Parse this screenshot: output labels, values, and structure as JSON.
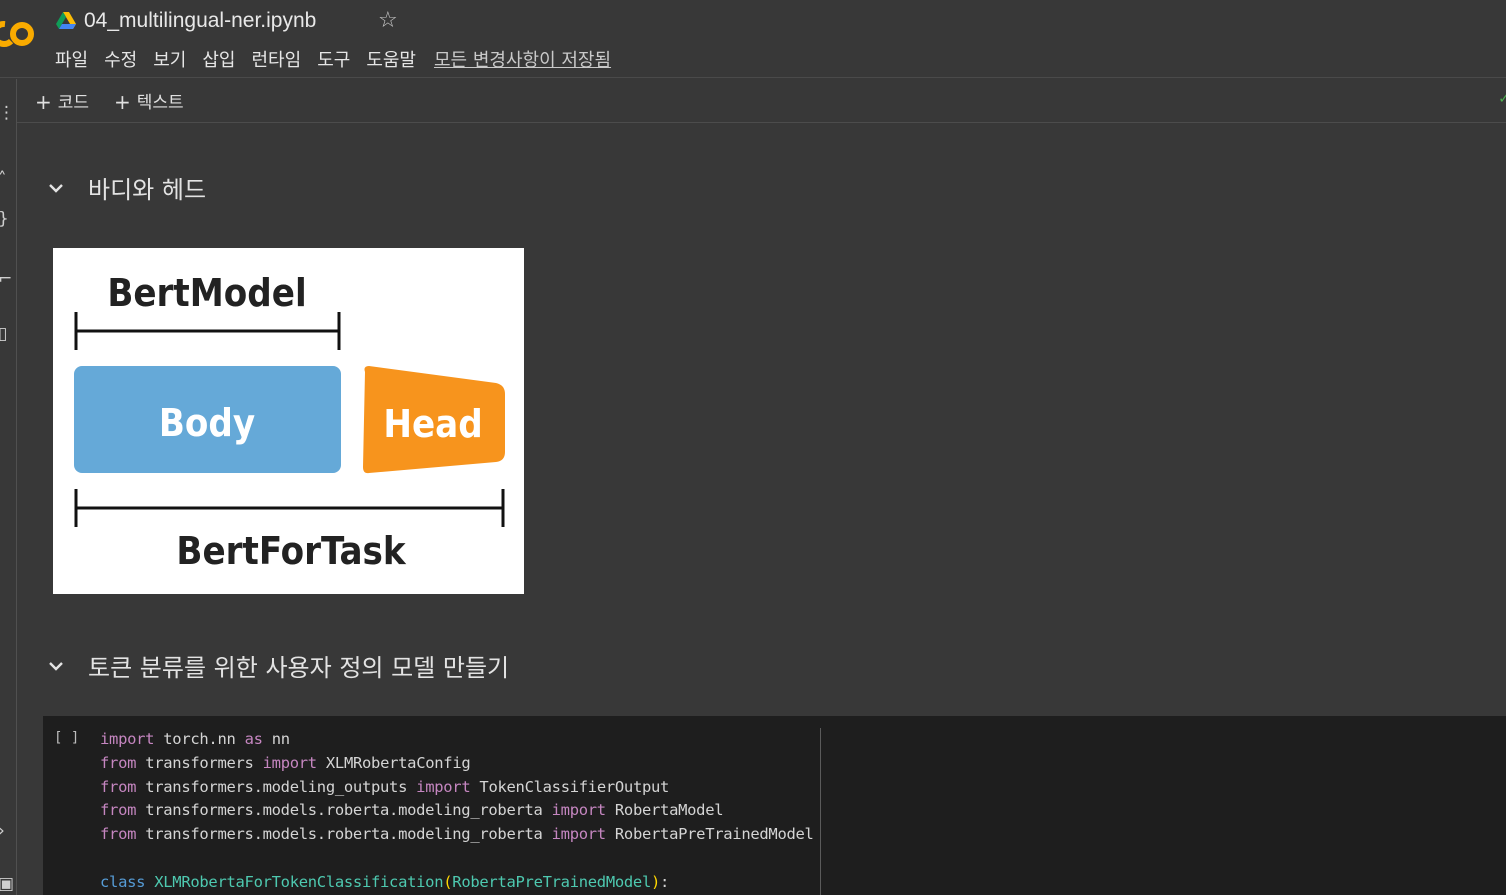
{
  "header": {
    "logo_text": "CO",
    "title": "04_multilingual-ner.ipynb",
    "menu": [
      "파일",
      "수정",
      "보기",
      "삽입",
      "런타임",
      "도구",
      "도움말"
    ],
    "saved_status": "모든 변경사항이 저장됨"
  },
  "toolbar": {
    "add_code": "코드",
    "add_text": "텍스트"
  },
  "sections": [
    {
      "title": "바디와 헤드"
    },
    {
      "title": "토큰 분류를 위한 사용자 정의 모델 만들기"
    }
  ],
  "diagram": {
    "top_label": "BertModel",
    "body_label": "Body",
    "head_label": "Head",
    "bottom_label": "BertForTask",
    "body_color": "#65a9d8",
    "head_color": "#f7941d"
  },
  "code_cell": {
    "run_indicator": "[ ]",
    "lines": [
      "import torch.nn as nn",
      "from transformers import XLMRobertaConfig",
      "from transformers.modeling_outputs import TokenClassifierOutput",
      "from transformers.models.roberta.modeling_roberta import RobertaModel",
      "from transformers.models.roberta.modeling_roberta import RobertaPreTrainedModel",
      "",
      "class XLMRobertaForTokenClassification(RobertaPreTrainedModel):"
    ]
  }
}
